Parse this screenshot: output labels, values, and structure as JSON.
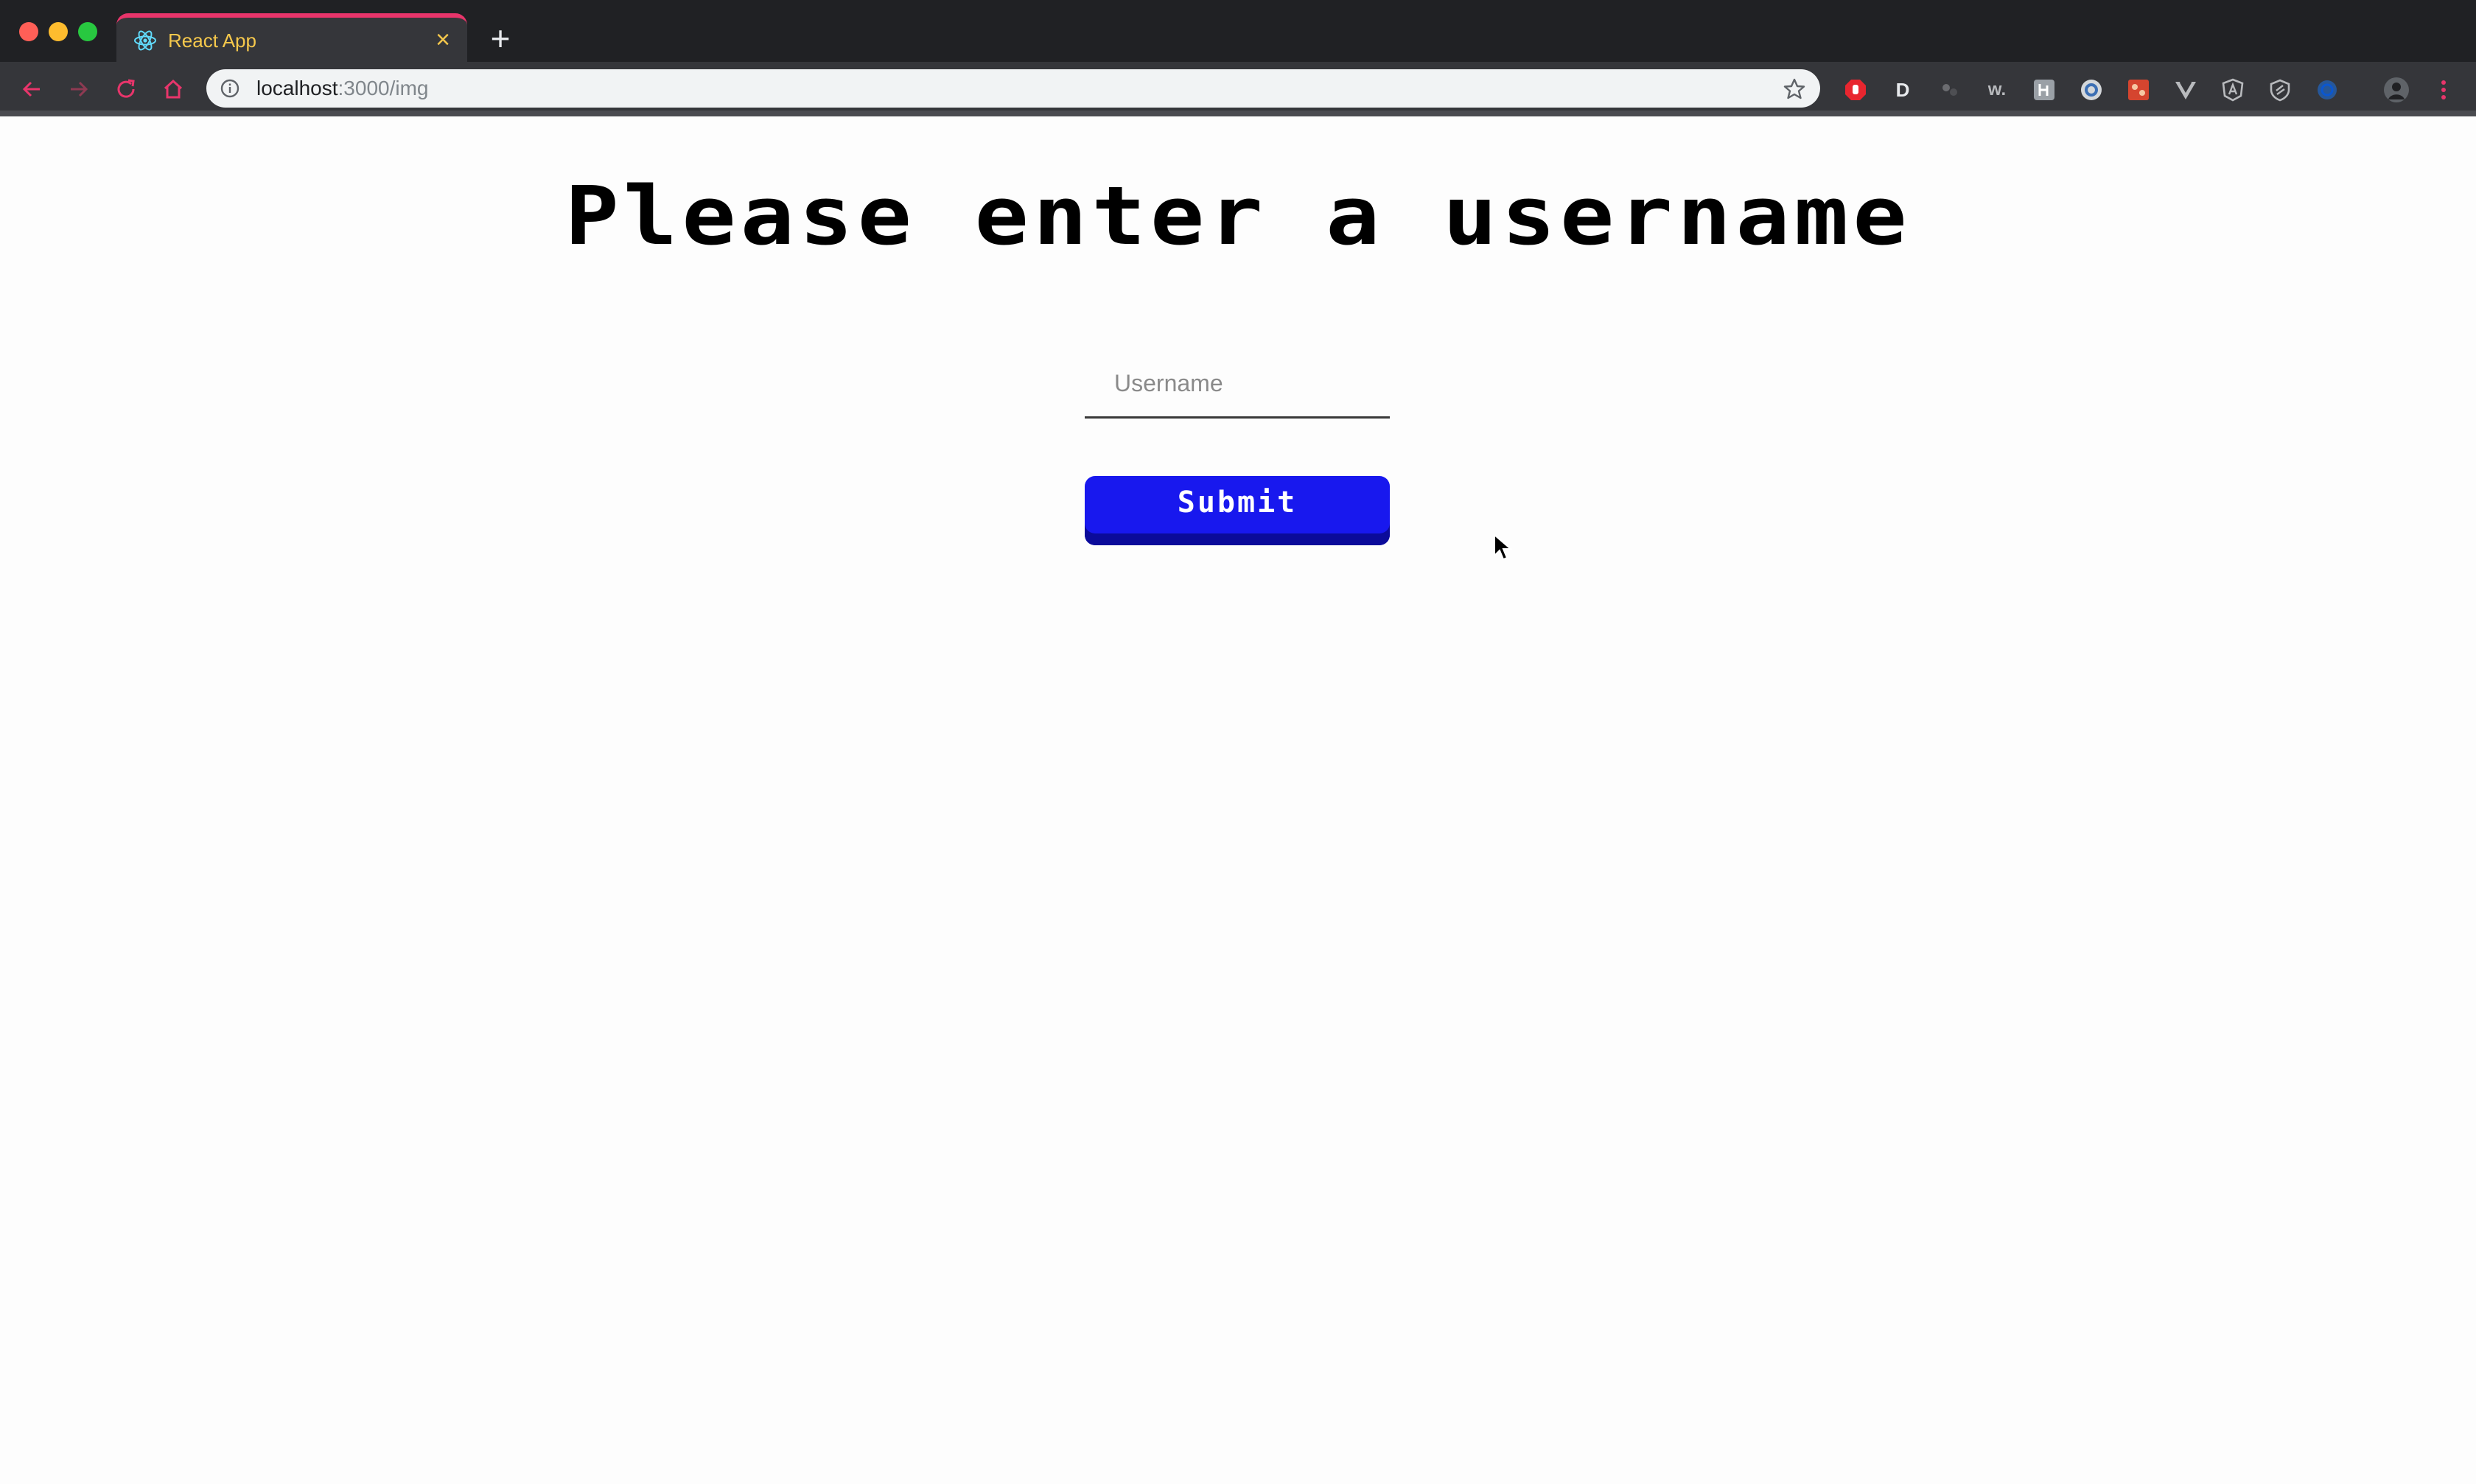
{
  "browser": {
    "tab_title": "React App",
    "tab_close": "×",
    "new_tab": "+",
    "url_host": "localhost",
    "url_path": ":3000/img",
    "extensions": [
      "adblock-icon",
      "d-icon",
      "dots-icon",
      "w-icon",
      "hub-icon",
      "ring-icon",
      "puzzle-icon",
      "vue-icon",
      "angular-icon",
      "shield-icon",
      "circle-icon",
      "profile-icon",
      "menu-icon"
    ],
    "ext_d_label": "D",
    "ext_w_label": "w.",
    "colors": {
      "tab_accent": "#e8356b",
      "tab_text": "#f5c84c",
      "chrome_bg": "#202124"
    }
  },
  "page": {
    "heading": "Please enter a username",
    "username_placeholder": "Username",
    "submit_label": "Submit",
    "colors": {
      "button": "#1818ee",
      "button_shadow": "#0b0b9a"
    }
  }
}
